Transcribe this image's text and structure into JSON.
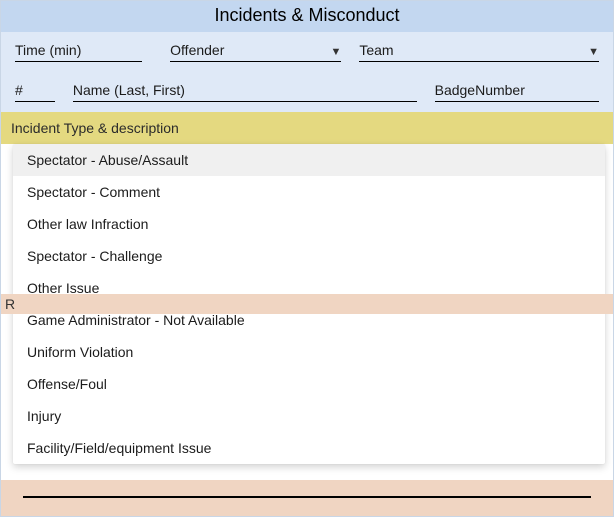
{
  "title": "Incidents & Misconduct",
  "fields": {
    "time_label": "Time (min)",
    "offender_label": "Offender",
    "team_label": "Team",
    "hash_label": "#",
    "name_label": "Name (Last, First)",
    "badge_label": "BadgeNumber"
  },
  "section_header": "Incident Type & description",
  "dropdown_items": [
    "Spectator - Abuse/Assault",
    "Spectator - Comment",
    "Other law Infraction",
    "Spectator - Challenge",
    "Other Issue",
    "Game Administrator - Not Available",
    "Uniform Violation",
    "Offense/Foul",
    "Injury",
    "Facility/Field/equipment Issue"
  ],
  "peeking_label": "R"
}
